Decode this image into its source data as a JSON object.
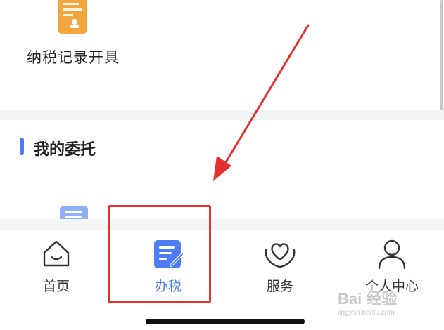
{
  "records": {
    "label": "纳税记录开具"
  },
  "entrust": {
    "title": "我的委托"
  },
  "tabbar": {
    "tabs": [
      {
        "label": "首页",
        "icon": "home-icon"
      },
      {
        "label": "办税",
        "icon": "tax-document-icon",
        "active": true
      },
      {
        "label": "服务",
        "icon": "heart-hands-icon"
      },
      {
        "label": "个人中心",
        "icon": "person-icon"
      }
    ]
  },
  "watermark": {
    "brand": "Bai 经验",
    "url": "jingyan.baidu.com"
  },
  "colors": {
    "accent": "#4e7cf6",
    "orange": "#f3a63e",
    "annotation": "#e5302d"
  }
}
